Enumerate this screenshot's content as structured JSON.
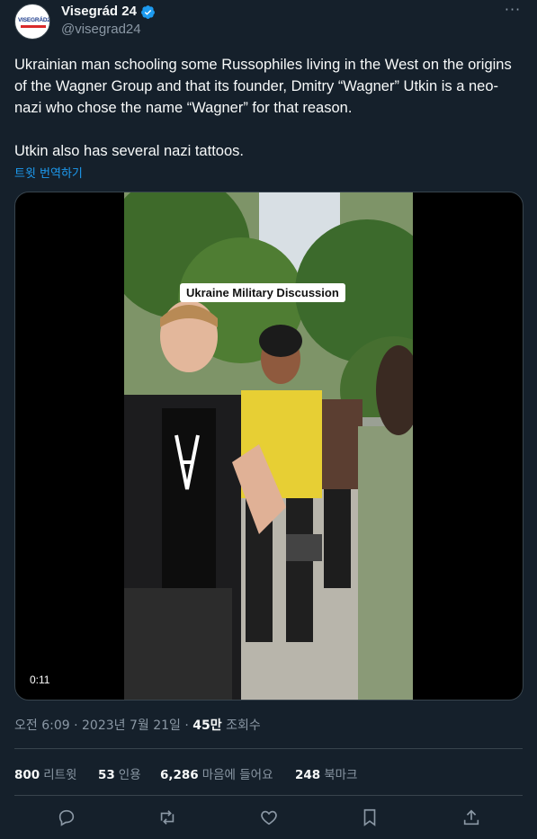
{
  "header": {
    "avatar_text": "VISEGRÁD24",
    "display_name": "Visegrád 24",
    "handle": "@visegrad24",
    "more_label": "···"
  },
  "tweet": {
    "text": "Ukrainian man schooling some Russophiles living in the West on the origins of the Wagner Group and that its founder, Dmitry “Wagner” Utkin is a neo-nazi who chose the name “Wagner” for that reason.\n\nUtkin also has several nazi tattoos.",
    "translate_label": "트윗 번역하기"
  },
  "media": {
    "overlay_caption": "Ukraine Military  Discussion",
    "duration": "0:11"
  },
  "meta": {
    "time": "오전 6:09",
    "date": "2023년 7월 21일",
    "views_count": "45만",
    "views_label": "조회수"
  },
  "stats": {
    "retweets_count": "800",
    "retweets_label": "리트윗",
    "quotes_count": "53",
    "quotes_label": "인용",
    "likes_count": "6,286",
    "likes_label": "마음에 들어요",
    "bookmarks_count": "248",
    "bookmarks_label": "북마크"
  },
  "colors": {
    "background": "#15202b",
    "text": "#f7f9f9",
    "muted": "#8b98a5",
    "accent": "#1d9bf0",
    "border": "#38444d"
  }
}
